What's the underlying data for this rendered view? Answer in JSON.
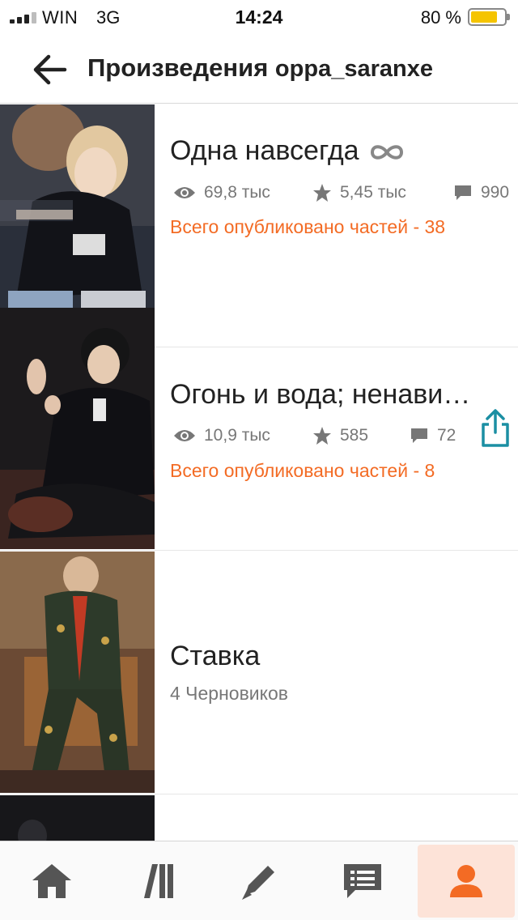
{
  "status_bar": {
    "carrier": "WIN",
    "network": "3G",
    "time": "14:24",
    "battery_text": "80 %",
    "battery_level": 0.8,
    "signal_bars_filled": 3,
    "battery_color": "#f5c400"
  },
  "header": {
    "title_bold": "Произведения",
    "username": "oppa_saranxe",
    "back_icon": "arrow-left-icon"
  },
  "stories": [
    {
      "title": "Одна навсегда",
      "title_icon": "infinity-icon",
      "reads": "69,8 тыс",
      "votes": "5,45 тыс",
      "comments": "990",
      "parts": "Всего опубликовано частей - 38"
    },
    {
      "title": "Огонь и вода; ненави…",
      "reads": "10,9 тыс",
      "votes": "585",
      "comments": "72",
      "parts": "Всего опубликовано частей - 8",
      "share_icon": "share-icon"
    },
    {
      "title": "Ставка",
      "drafts": "4 Черновиков"
    }
  ],
  "tab_bar": {
    "tabs": [
      {
        "name": "home-icon",
        "active": false
      },
      {
        "name": "library-icon",
        "active": false
      },
      {
        "name": "write-icon",
        "active": false
      },
      {
        "name": "messages-icon",
        "active": false
      },
      {
        "name": "profile-icon",
        "active": true
      }
    ],
    "accent": "#f36b24"
  },
  "colors": {
    "accent_orange": "#f36b24",
    "share_teal": "#1b8fa3",
    "meta_gray": "#777777"
  }
}
